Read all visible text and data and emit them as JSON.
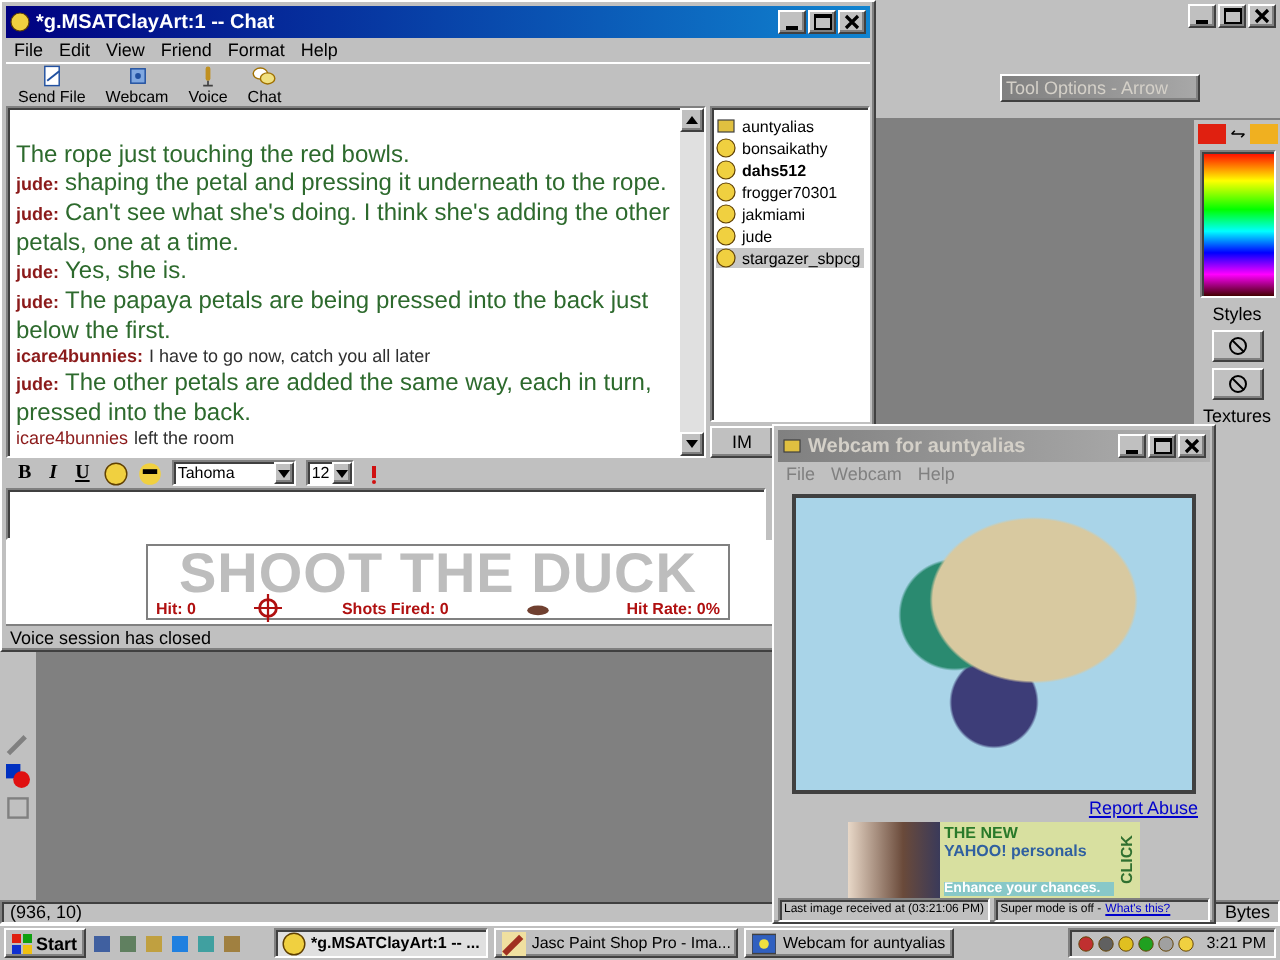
{
  "paint_app": {
    "tool_options_title": "Tool Options - Arrow",
    "palette_labels": [
      "Styles",
      "Textures"
    ],
    "status": "(936, 10)",
    "bytes": "Bytes"
  },
  "chat_window": {
    "title": "*g.MSATClayArt:1 -- Chat",
    "active": true,
    "menu": [
      "File",
      "Edit",
      "View",
      "Friend",
      "Format",
      "Help"
    ],
    "toolbar": [
      {
        "label": "Send File",
        "kind": "file"
      },
      {
        "label": "Webcam",
        "kind": "webcam"
      },
      {
        "label": "Voice",
        "kind": "voice"
      },
      {
        "label": "Chat",
        "kind": "chat"
      }
    ],
    "messages": [
      {
        "kind": "continuation",
        "text": "The rope just touching the red bowls."
      },
      {
        "kind": "styled",
        "speaker": "jude:",
        "text": "shaping the petal and pressing it underneath to the rope."
      },
      {
        "kind": "styled",
        "speaker": "jude:",
        "text": "Can't see what she's doing. I think she's adding the other petals, one at a time."
      },
      {
        "kind": "styled",
        "speaker": "jude:",
        "text": "Yes, she is."
      },
      {
        "kind": "styled",
        "speaker": "jude:",
        "text": "The papaya petals are being pressed into the back just below the first."
      },
      {
        "kind": "plain",
        "speaker": "icare4bunnies:",
        "text": "I have to go now, catch you all later"
      },
      {
        "kind": "styled",
        "speaker": "jude:",
        "text": "The other petals are added the same way, each in turn, pressed into the back."
      },
      {
        "kind": "event",
        "speaker": "icare4bunnies",
        "text": "left the room"
      }
    ],
    "users": [
      {
        "name": "auntyalias",
        "webcam": true,
        "friend": false,
        "selected": false
      },
      {
        "name": "bonsaikathy",
        "webcam": false,
        "friend": false,
        "selected": false
      },
      {
        "name": "dahs512",
        "webcam": false,
        "friend": true,
        "selected": false
      },
      {
        "name": "frogger70301",
        "webcam": false,
        "friend": false,
        "selected": false
      },
      {
        "name": "jakmiami",
        "webcam": false,
        "friend": false,
        "selected": false
      },
      {
        "name": "jude",
        "webcam": false,
        "friend": false,
        "selected": false
      },
      {
        "name": "stargazer_sbpcg",
        "webcam": false,
        "friend": false,
        "selected": true
      }
    ],
    "im_button": "IM",
    "format_bar": {
      "bold": "B",
      "italic": "I",
      "underline": "U",
      "font": "Tahoma",
      "size": "12"
    },
    "banner": {
      "title": "SHOOT THE DUCK",
      "stats": [
        "Hit: 0",
        "Shots Fired: 0",
        "Hit Rate: 0%"
      ]
    },
    "status": "Voice session has closed"
  },
  "webcam_window": {
    "title": "Webcam for auntyalias",
    "active": false,
    "menu": [
      "File",
      "Webcam",
      "Help"
    ],
    "report_link": "Report Abuse",
    "ad": {
      "headline": "THE NEW",
      "brand": "YAHOO!",
      "product": "personals",
      "tagline": "Enhance your chances.",
      "cta": "CLICK"
    },
    "status": "Last image received at (03:21:06 PM)",
    "super_mode": "Super mode is off - ",
    "super_link": "What's this?"
  },
  "taskbar": {
    "start": "Start",
    "tasks": [
      {
        "label": "*g.MSATClayArt:1 -- ...",
        "selected": true,
        "kind": "chat"
      },
      {
        "label": "Jasc Paint Shop Pro - Ima...",
        "selected": false,
        "kind": "paint"
      },
      {
        "label": "Webcam for auntyalias",
        "selected": false,
        "kind": "webcam"
      }
    ],
    "clock": "3:21 PM"
  }
}
